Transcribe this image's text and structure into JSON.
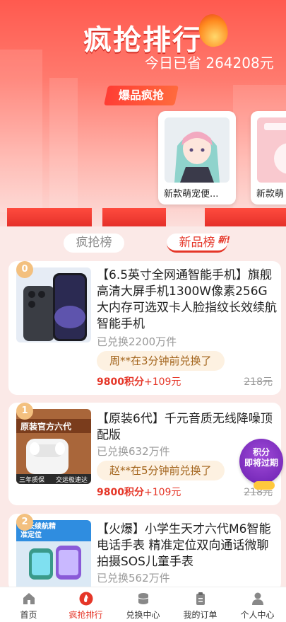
{
  "hero": {
    "title": "疯抢排行",
    "saved_text": "今日已省 264208元",
    "ribbon": "爆品疯抢",
    "promo_items": [
      {
        "name": "新款萌宠便..."
      },
      {
        "name": "新款萌"
      }
    ]
  },
  "tabs": [
    {
      "label": "疯抢榜",
      "active": false
    },
    {
      "label": "新品榜",
      "active": true,
      "badge": "新!"
    }
  ],
  "products": [
    {
      "rank": "0",
      "title": "【6.5英寸全网通智能手机】旗舰高清大屏手机1300W像素256G大内存可选双卡人脸指纹长效续航智能手机",
      "sold": "已兑换2200万件",
      "ticker": "周**在3分钟前兑换了",
      "points": "9800积分",
      "cash": "+109元",
      "old_price": "218元"
    },
    {
      "rank": "1",
      "title": "【原装6代】千元音质无线降噪顶配版",
      "sold": "已兑换632万件",
      "ticker": "赵**在5分钟前兑换了",
      "points": "9800积分",
      "cash": "+109元",
      "old_price": "218元",
      "thumb_banner": "原装官方六代",
      "thumb_footer": "三年质保",
      "thumb_footer2": "交运极速达"
    },
    {
      "rank": "2",
      "title": "【火爆】小学生天才六代M6智能电话手表 精准定位双向通话微聊拍摄SOS儿童手表",
      "sold": "已兑换562万件",
      "thumb_banner": "超长续航精准定位"
    }
  ],
  "float_badge": {
    "line1": "积分",
    "line2": "即将过期"
  },
  "nav": [
    {
      "label": "首页",
      "icon": "home-icon",
      "active": false
    },
    {
      "label": "疯抢排行",
      "icon": "flame-icon",
      "active": true
    },
    {
      "label": "兑换中心",
      "icon": "coins-icon",
      "active": false
    },
    {
      "label": "我的订单",
      "icon": "clipboard-icon",
      "active": false
    },
    {
      "label": "个人中心",
      "icon": "user-icon",
      "active": false
    }
  ],
  "colors": {
    "accent": "#e53628",
    "hero_top": "#ff5a4f",
    "gold": "#f3c07f"
  }
}
